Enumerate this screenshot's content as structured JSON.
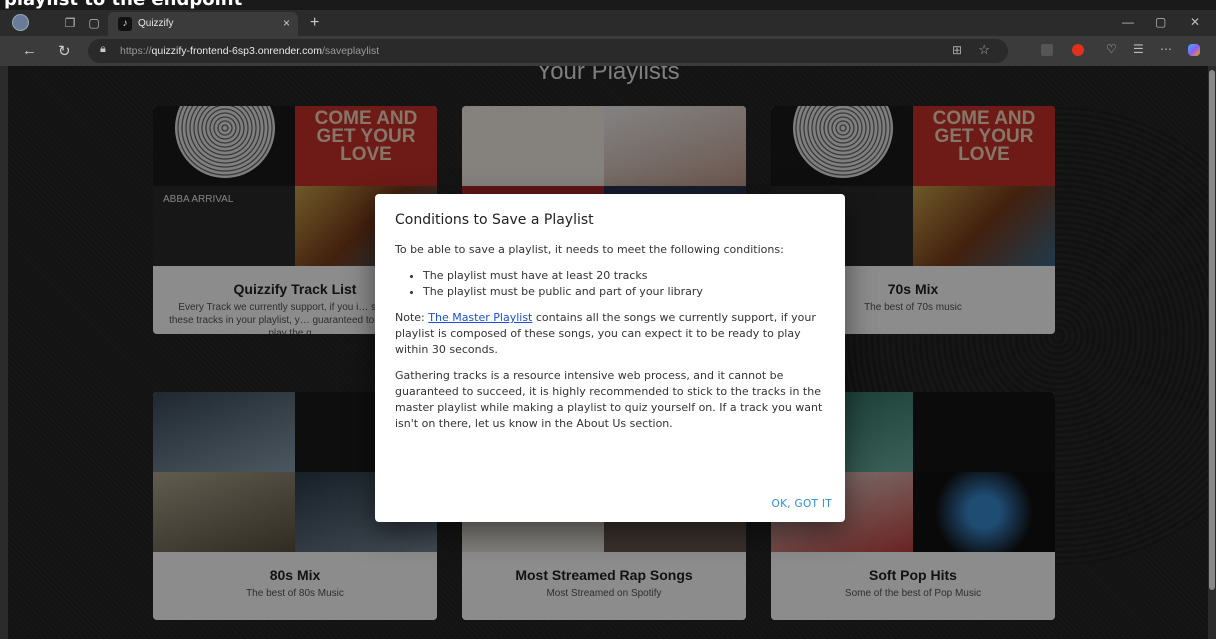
{
  "window": {
    "top_title_fragment": "playlist to the endpoint",
    "tab_title": "Quizzify",
    "tab_close": "×",
    "new_tab": "+",
    "minimize": "—",
    "maximize": "▢",
    "close": "✕"
  },
  "addressbar": {
    "back": "←",
    "refresh": "↻",
    "lock_icon": "lock-icon",
    "url_prefix": "https://",
    "url_host": "quizzify-frontend-6sp3.onrender.com",
    "url_path": "/saveplaylist"
  },
  "page": {
    "heading": "Your Playlists",
    "cards": [
      {
        "title": "Quizzify Track List",
        "description": "Every Track we currently support, if you i… subset of these tracks in your playlist, y… guaranteed to be able to play the q…"
      },
      {
        "title": "",
        "description": ""
      },
      {
        "title": "70s Mix",
        "description": "The best of 70s music"
      },
      {
        "title": "80s Mix",
        "description": "The best of 80s Music"
      },
      {
        "title": "Most Streamed Rap Songs",
        "description": "Most Streamed on Spotify"
      },
      {
        "title": "Soft Pop Hits",
        "description": "Some of the best of Pop Music"
      }
    ],
    "album_texts": {
      "come_and_get": "COME AND GET YOUR LOVE",
      "abba": "ABBA ARRIVAL",
      "arrival": "ARRIVAL"
    }
  },
  "modal": {
    "title": "Conditions to Save a Playlist",
    "intro": "To be able to save a playlist, it needs to meet the following conditions:",
    "conditions": [
      "The playlist must have at least 20 tracks",
      "The playlist must be public and part of your library"
    ],
    "note_prefix": "Note: ",
    "note_link": "The Master Playlist",
    "note_suffix": " contains all the songs we currently support, if your playlist is composed of these songs, you can expect it to be ready to play within 30 seconds.",
    "gathering": "Gathering tracks is a resource intensive web process, and it cannot be guaranteed to succeed, it is highly recommended to stick to the tracks in the master playlist while making a playlist to quiz yourself on. If a track you want isn't on there, let us know in the About Us section.",
    "ok_label": "OK, GOT IT"
  },
  "colors": {
    "link": "#1a4fd6",
    "ok_button": "#2d8ee0",
    "browser_chrome": "#2b2b2b"
  }
}
